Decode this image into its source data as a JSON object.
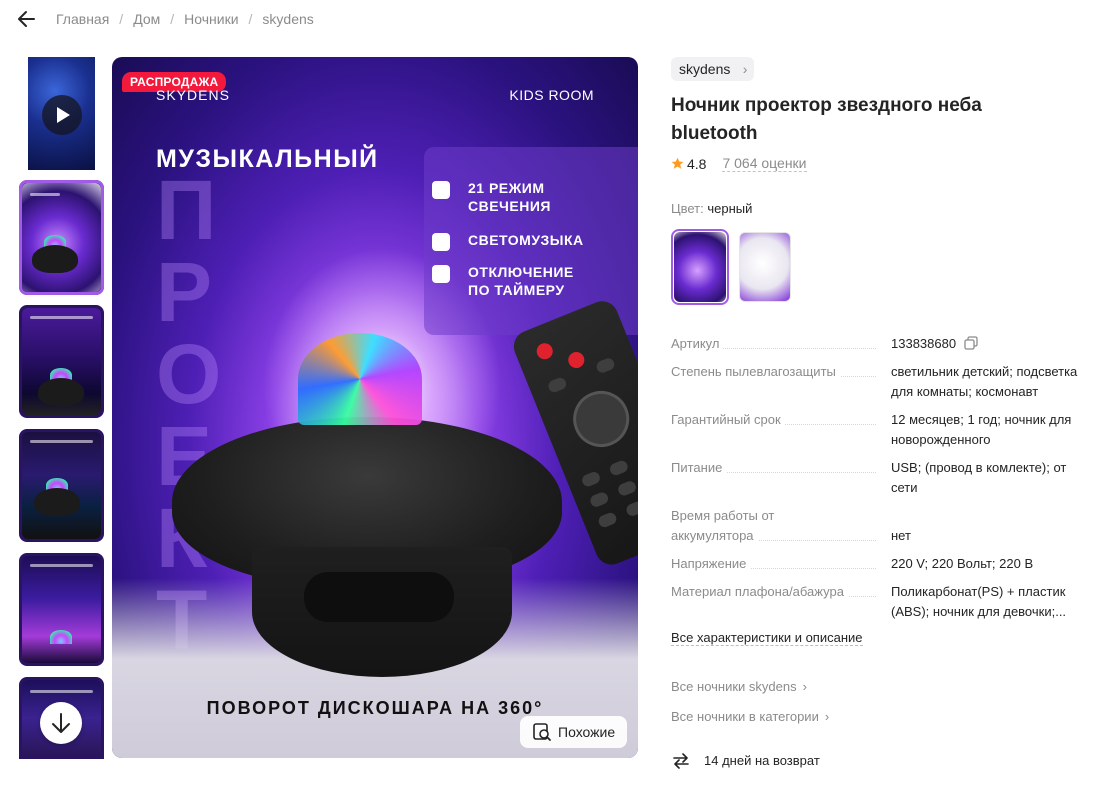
{
  "breadcrumb": [
    "Главная",
    "Дом",
    "Ночники",
    "skydens"
  ],
  "gallery": {
    "thumbnails": [
      {
        "type": "video"
      },
      {
        "type": "image",
        "active": true
      },
      {
        "type": "image"
      },
      {
        "type": "image"
      },
      {
        "type": "image"
      },
      {
        "type": "image"
      }
    ],
    "main": {
      "sale_badge": "РАСПРОДАЖА",
      "brand_mark": "SKYDENS",
      "room_mark": "KIDS ROOM",
      "headline": "МУЗЫКАЛЬНЫЙ",
      "ghost_text": "ПРОЕКТОР",
      "features": [
        {
          "icon": "led-icon",
          "text": "21 РЕЖИМ\nСВЕЧЕНИЯ"
        },
        {
          "icon": "bluetooth-icon",
          "text": "СВЕТОМУЗЫКА"
        },
        {
          "icon": "lightning-icon",
          "text": "ОТКЛЮЧЕНИЕ\nПО ТАЙМЕРУ"
        }
      ],
      "caption": "ПОВОРОТ ДИСКОШАРА НА 360°",
      "similar_label": "Похожие"
    }
  },
  "product": {
    "brand": "skydens",
    "title": "Ночник проектор звездного неба bluetooth",
    "rating": "4.8",
    "reviews": "7 064 оценки",
    "color_label": "Цвет:",
    "color_value": "черный",
    "swatches": [
      "black",
      "white"
    ],
    "specs": [
      {
        "key": "Артикул",
        "value": "133838680"
      },
      {
        "key": "Степень пылевлагозащиты",
        "value": "светильник детский; подсветка для комнаты; космонавт"
      },
      {
        "key": "Гарантийный срок",
        "value": "12 месяцев; 1 год; ночник для новорожденного"
      },
      {
        "key": "Питание",
        "value": "USB; (провод в комлекте); от сети"
      },
      {
        "key": "Время работы от аккумулятора",
        "value": "нет"
      },
      {
        "key": "Напряжение",
        "value": "220 V; 220 Вольт; 220 В"
      },
      {
        "key": "Материал плафона/абажура",
        "value": "Поликарбонат(PS) + пластик (ABS); ночник для девочки;..."
      }
    ],
    "all_specs_link": "Все характеристики и описание",
    "brand_link": "Все ночники skydens",
    "category_link": "Все ночники в категории",
    "return_text": "14 дней на возврат"
  },
  "colors": {
    "accent": "#a25be6",
    "sale": "#f2193c",
    "star": "#ff9a1f"
  }
}
